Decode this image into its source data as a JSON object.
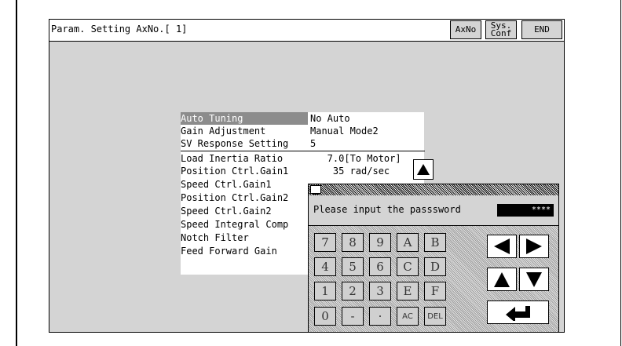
{
  "window": {
    "title": "Param. Setting AxNo.[ 1]"
  },
  "toolbar": {
    "axno_label": "AxNo",
    "sysconf_line1": "Sys.",
    "sysconf_line2": "Conf",
    "end_label": "END"
  },
  "params": [
    {
      "name": "Auto Tuning",
      "value": "No Auto",
      "selected": true
    },
    {
      "name": "Gain Adjustment",
      "value": "Manual Mode2"
    },
    {
      "name": "SV Response Setting",
      "value": "5"
    },
    {
      "name": "Load Inertia Ratio",
      "value": "   7.0[To Motor]"
    },
    {
      "name": "Position Ctrl.Gain1",
      "value": "    35 rad/sec"
    },
    {
      "name": "Speed Ctrl.Gain1",
      "value": ""
    },
    {
      "name": "Position Ctrl.Gain2",
      "value": ""
    },
    {
      "name": "Speed Ctrl.Gain2",
      "value": ""
    },
    {
      "name": "Speed Integral Comp",
      "value": ""
    },
    {
      "name": "Notch Filter",
      "value": ""
    },
    {
      "name": "Feed Forward Gain",
      "value": ""
    }
  ],
  "keypad": {
    "prompt": "Please input the passsword",
    "password_masked": "****",
    "rows": [
      [
        "7",
        "8",
        "9",
        "A",
        "B"
      ],
      [
        "4",
        "5",
        "6",
        "C",
        "D"
      ],
      [
        "1",
        "2",
        "3",
        "E",
        "F"
      ],
      [
        "0",
        "-",
        "·",
        "AC",
        "DEL"
      ]
    ]
  },
  "icons": {
    "up": "triangle-up-icon",
    "left": "arrow-left-icon",
    "right": "arrow-right-icon",
    "down": "arrow-down-icon",
    "enter": "enter-icon"
  },
  "colors": {
    "screen_bg": "#d4d4d4",
    "selection": "#8c8c8c",
    "password_bg": "#000000"
  }
}
